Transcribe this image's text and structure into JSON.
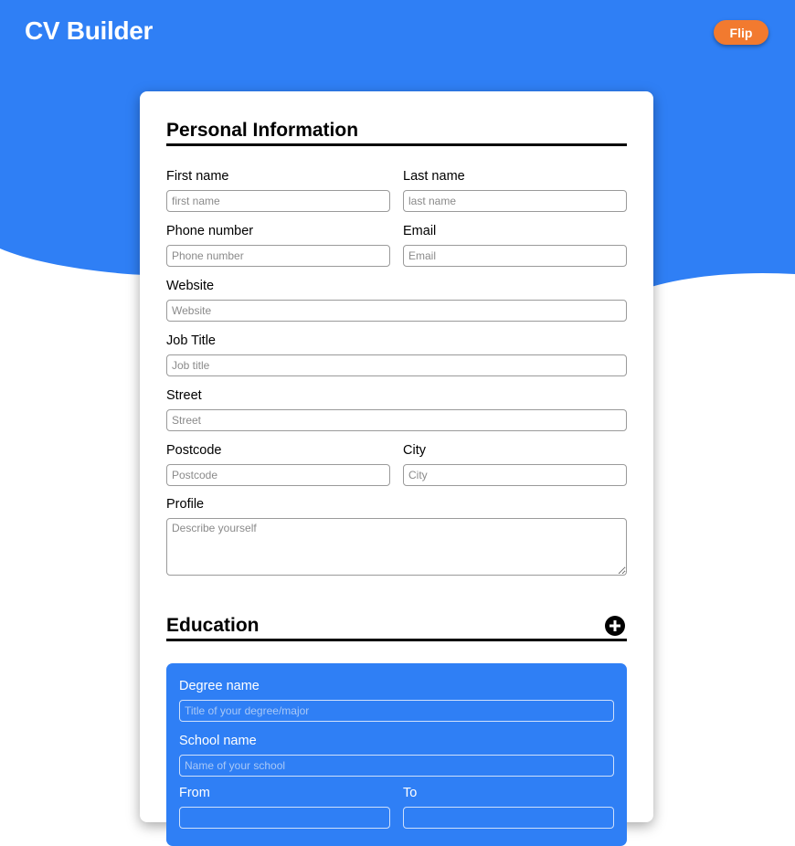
{
  "app": {
    "title": "CV Builder",
    "flip_label": "Flip",
    "accent": "#2f7ff5",
    "flip_color": "#f27a2f"
  },
  "personal": {
    "heading": "Personal Information",
    "fields": {
      "first_name": {
        "label": "First name",
        "placeholder": "first name"
      },
      "last_name": {
        "label": "Last name",
        "placeholder": "last name"
      },
      "phone": {
        "label": "Phone number",
        "placeholder": "Phone number"
      },
      "email": {
        "label": "Email",
        "placeholder": "Email"
      },
      "website": {
        "label": "Website",
        "placeholder": "Website"
      },
      "job_title": {
        "label": "Job Title",
        "placeholder": "Job title"
      },
      "street": {
        "label": "Street",
        "placeholder": "Street"
      },
      "postcode": {
        "label": "Postcode",
        "placeholder": "Postcode"
      },
      "city": {
        "label": "City",
        "placeholder": "City"
      },
      "profile": {
        "label": "Profile",
        "placeholder": "Describe yourself"
      }
    }
  },
  "education": {
    "heading": "Education",
    "add_icon": "plus-circle-icon",
    "entry": {
      "degree": {
        "label": "Degree name",
        "placeholder": "Title of your degree/major"
      },
      "school": {
        "label": "School name",
        "placeholder": "Name of your school"
      },
      "from": {
        "label": "From"
      },
      "to": {
        "label": "To"
      }
    }
  }
}
